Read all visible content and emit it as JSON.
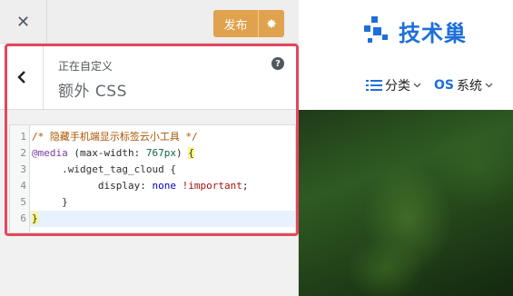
{
  "sidebar": {
    "close_glyph": "✕",
    "publish_label": "发布",
    "breadcrumb": "正在自定义",
    "section_title": "额外 CSS",
    "help_glyph": "?",
    "line_numbers": [
      "1",
      "2",
      "3",
      "4",
      "5",
      "6"
    ],
    "code": {
      "l1": "/* 隐藏手机端显示标签云小工具 */",
      "l2_at": "@media",
      "l2_open": " (max-width: ",
      "l2_num": "767px",
      "l2_close": ") ",
      "l2_brace": "{",
      "l3_sel": "     .widget_tag_cloud {",
      "l4_indent": "           ",
      "l4_prop": "display",
      "l4_colon": ": ",
      "l4_kw": "none",
      "l4_sp": " ",
      "l4_imp": "!important",
      "l4_semi": ";",
      "l5": "     }",
      "l6": "}"
    }
  },
  "preview": {
    "logo_text": "技术巢",
    "nav": [
      {
        "label": "分类"
      },
      {
        "label": "OS系统"
      }
    ],
    "brand_color": "#1e6fd9"
  },
  "colors": {
    "publish": "#e0a24e",
    "annotation": "#e2485c"
  }
}
